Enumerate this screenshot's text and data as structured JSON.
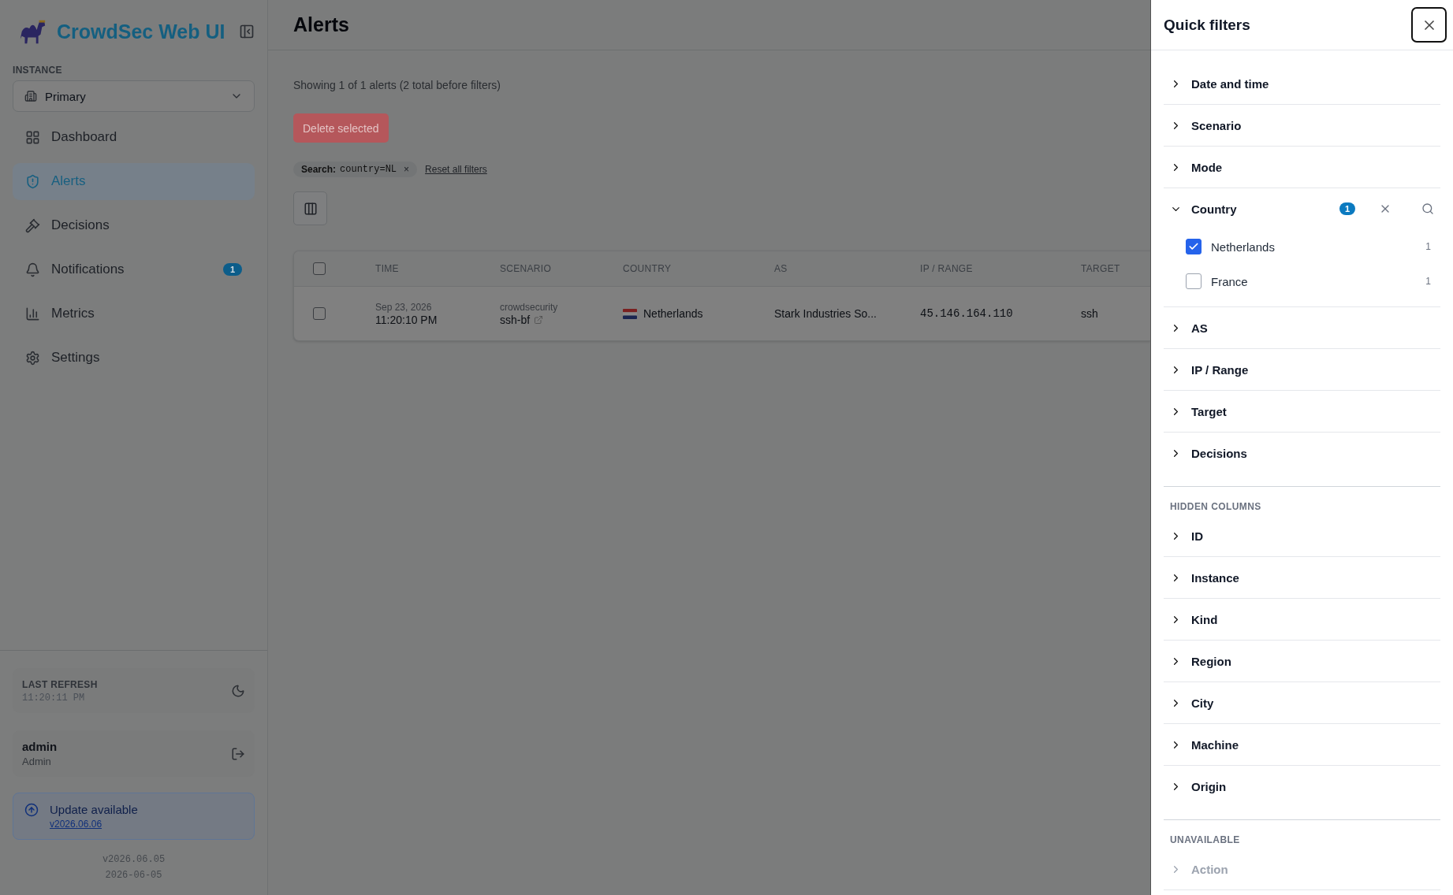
{
  "sidebar": {
    "app_title": "CrowdSec Web UI",
    "instance_label": "INSTANCE",
    "instance": "Primary",
    "nav": [
      {
        "kind": "dashboard",
        "label": "Dashboard",
        "selected": false
      },
      {
        "kind": "alerts",
        "label": "Alerts",
        "selected": true
      },
      {
        "kind": "decisions",
        "label": "Decisions",
        "selected": false
      },
      {
        "kind": "notifications",
        "label": "Notifications",
        "selected": false,
        "badge": "1"
      },
      {
        "kind": "metrics",
        "label": "Metrics",
        "selected": false
      },
      {
        "kind": "settings",
        "label": "Settings",
        "selected": false
      }
    ],
    "last_refresh": {
      "label": "LAST REFRESH",
      "time": "11:20:11 PM"
    },
    "user": {
      "name": "admin",
      "role": "Admin"
    },
    "update": {
      "title": "Update available",
      "version": "v2026.06.06"
    },
    "version": "v2026.06.05",
    "build_date": "2026-06-05"
  },
  "main": {
    "title": "Alerts",
    "summary": "Showing 1 of 1 alerts (2 total before filters)",
    "delete_button": "Delete selected",
    "filter_chip": {
      "label": "Search:",
      "value": "country=NL",
      "remove": "×"
    },
    "reset_link": "Reset all filters",
    "table": {
      "header_checked": false,
      "columns": [
        "TIME",
        "SCENARIO",
        "COUNTRY",
        "AS",
        "IP / RANGE",
        "TARGET"
      ],
      "rows": [
        {
          "checked": false,
          "date": "Sep 23, 2026",
          "time": "11:20:10 PM",
          "scenario_source": "crowdsecurity",
          "scenario": "ssh-bf",
          "country": "Netherlands",
          "as": "Stark Industries So...",
          "ip": "45.146.164.110",
          "target": "ssh"
        }
      ]
    }
  },
  "drawer": {
    "title": "Quick filters",
    "sections": [
      {
        "filters": [
          {
            "label": "Date and time",
            "expanded": false,
            "disabled": false
          },
          {
            "label": "Scenario",
            "expanded": false,
            "disabled": false
          },
          {
            "label": "Mode",
            "expanded": false,
            "disabled": false
          },
          {
            "label": "Country",
            "expanded": true,
            "disabled": false,
            "badge": "1",
            "options": [
              {
                "label": "Netherlands",
                "checked": true,
                "count": "1"
              },
              {
                "label": "France",
                "checked": false,
                "count": "1"
              }
            ]
          },
          {
            "label": "AS",
            "expanded": false,
            "disabled": false
          },
          {
            "label": "IP / Range",
            "expanded": false,
            "disabled": false
          },
          {
            "label": "Target",
            "expanded": false,
            "disabled": false
          },
          {
            "label": "Decisions",
            "expanded": false,
            "disabled": false
          }
        ]
      },
      {
        "heading": "HIDDEN COLUMNS",
        "filters": [
          {
            "label": "ID",
            "expanded": false,
            "disabled": false
          },
          {
            "label": "Instance",
            "expanded": false,
            "disabled": false
          },
          {
            "label": "Kind",
            "expanded": false,
            "disabled": false
          },
          {
            "label": "Region",
            "expanded": false,
            "disabled": false
          },
          {
            "label": "City",
            "expanded": false,
            "disabled": false
          },
          {
            "label": "Machine",
            "expanded": false,
            "disabled": false
          },
          {
            "label": "Origin",
            "expanded": false,
            "disabled": false
          }
        ]
      },
      {
        "heading": "UNAVAILABLE",
        "filters": [
          {
            "label": "Action",
            "expanded": false,
            "disabled": true
          }
        ]
      }
    ]
  }
}
